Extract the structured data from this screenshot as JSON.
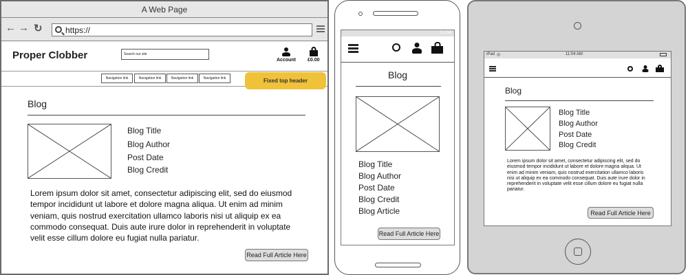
{
  "desktop": {
    "window_title": "A Web Page",
    "url": "https://",
    "brand": "Proper Clobber",
    "search_placeholder": "Search our site",
    "account_label": "Account",
    "basket_label": "£0.00",
    "nav_links": [
      "Navigation link",
      "Navigation link",
      "Navigation link",
      "Navigation link"
    ],
    "fixed_header_note": "Fixed top header"
  },
  "phone": {
    "status_time": "11:04"
  },
  "tablet": {
    "status_device": "iPad",
    "status_time": "11:04 AM"
  },
  "blog": {
    "heading": "Blog",
    "meta": [
      "Blog Title",
      "Blog Author",
      "Post Date",
      "Blog Credit"
    ],
    "article_label": "Blog Article",
    "body": "Lorem ipsum dolor sit amet, consectetur adipiscing elit, sed do eiusmod tempor incididunt ut labore et dolore magna aliqua. Ut enim ad minim veniam, quis nostrud exercitation ullamco laboris nisi ut aliquip ex ea commodo consequat. Duis aute irure dolor in reprehenderit in voluptate velit esse cillum dolore eu fugiat nulla pariatur.",
    "read_more": "Read Full Article Here"
  },
  "icons": [
    "back-arrow-icon",
    "forward-arrow-icon",
    "refresh-icon",
    "search-icon",
    "menu-icon",
    "account-icon",
    "basket-icon",
    "wifi-icon",
    "battery-icon",
    "home-button-icon",
    "camera-icon",
    "speaker-icon"
  ],
  "colors": {
    "note": "#f0c23a",
    "frame": "#6a6a6a",
    "tablet_bezel": "#d4d4d4"
  }
}
